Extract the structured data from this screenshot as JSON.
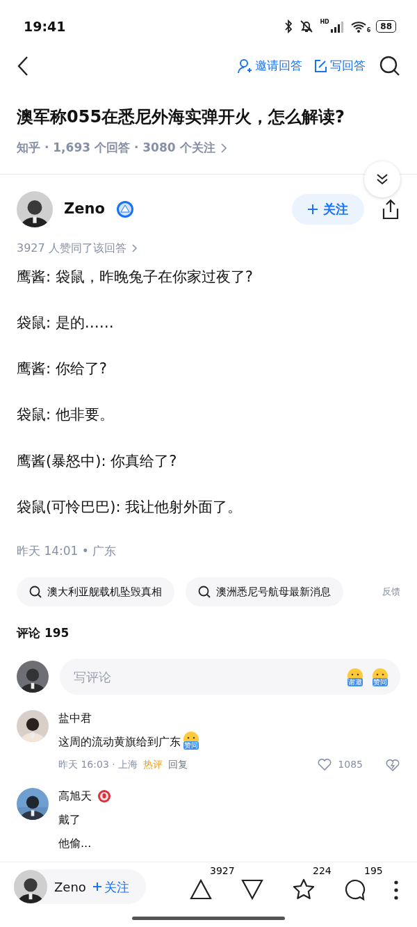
{
  "status_bar": {
    "time": "19:41",
    "network": "HD",
    "wifi": "6",
    "battery": "88"
  },
  "nav": {
    "invite": "邀请回答",
    "write": "写回答"
  },
  "question": {
    "title": "澳军称055在悉尼外海实弹开火，怎么解读?",
    "meta": "知乎 · 1,693 个回答 · 3080 个关注"
  },
  "author": {
    "name": "Zeno",
    "follow": "关注"
  },
  "answer": {
    "votes": "3927 人赞同了该回答",
    "paragraphs": [
      "鹰酱: 袋鼠，昨晚兔子在你家过夜了?",
      "袋鼠: 是的……",
      "鹰酱: 你给了?",
      "袋鼠: 他非要。",
      "鹰酱(暴怒中): 你真给了?",
      "袋鼠(可怜巴巴): 我让他射外面了。"
    ],
    "time": "昨天 14:01 • 广东"
  },
  "related_searches": [
    "澳大利亚舰载机坠毁真相",
    "澳洲悉尼号航母最新消息"
  ],
  "feedback": "反馈",
  "comments": {
    "header": "评论 195",
    "placeholder": "写评论",
    "stickers": [
      "谢邀",
      "赞同"
    ],
    "items": [
      {
        "name": "盐中君",
        "badge": false,
        "lines": [
          "这周的流动黄旗给到广东"
        ],
        "sticker": "赞同",
        "meta": {
          "when": "昨天 16:03 · 上海",
          "hot": "热评",
          "reply": "回复",
          "likes": "1085"
        }
      },
      {
        "name": "高旭天",
        "badge": true,
        "lines": [
          "戴了",
          "他偷..."
        ]
      }
    ]
  },
  "bottom_bar": {
    "name": "Zeno",
    "follow": "关注",
    "upvotes": "3927",
    "favorites": "224",
    "comments": "195"
  }
}
